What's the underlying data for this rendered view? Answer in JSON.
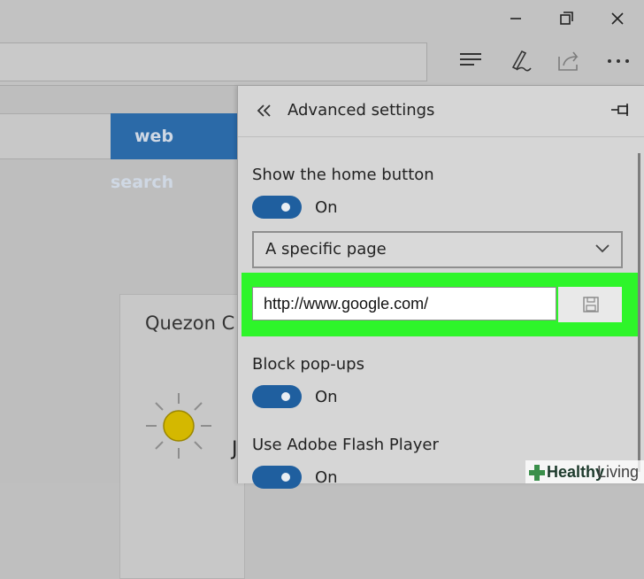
{
  "window": {
    "icons": [
      "minimize-icon",
      "restore-icon",
      "close-icon"
    ]
  },
  "toolbar": {
    "icons": [
      "hub-icon",
      "web-note-icon",
      "share-icon",
      "more-icon"
    ]
  },
  "page": {
    "search_button": "web search",
    "weather_city": "Quezon C",
    "weather_temp_fragment": "",
    "weather_fragment_2": "J"
  },
  "panel": {
    "title": "Advanced settings",
    "home_button": {
      "label": "Show the home button",
      "toggle_state": "On",
      "dropdown_value": "A specific page",
      "url_value": "http://www.google.com/"
    },
    "block_popups": {
      "label": "Block pop-ups",
      "toggle_state": "On"
    },
    "flash": {
      "label": "Use Adobe Flash Player",
      "toggle_state": "On"
    }
  },
  "watermark": {
    "part1": "Healthy",
    "part2": "Living"
  },
  "colors": {
    "accent": "#1f5f9f",
    "highlight": "#2ef52a",
    "search_button": "#2b6aa8"
  }
}
